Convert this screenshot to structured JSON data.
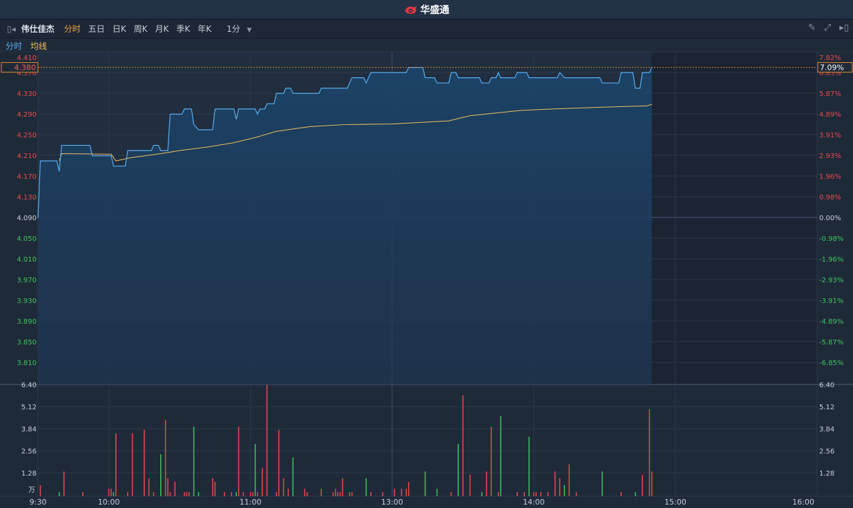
{
  "titlebar": {
    "app_name": "华盛通"
  },
  "toolbar": {
    "stock_name": "伟仕佳杰",
    "tabs": [
      {
        "label": "分时",
        "active": true
      },
      {
        "label": "五日"
      },
      {
        "label": "日K"
      },
      {
        "label": "周K"
      },
      {
        "label": "月K"
      },
      {
        "label": "季K"
      },
      {
        "label": "年K"
      }
    ],
    "interval": {
      "label": "1分"
    },
    "tools": [
      "pencil-icon",
      "fullscreen-icon",
      "collapse-right-icon"
    ]
  },
  "legend": {
    "price_label": "分时",
    "avg_label": "均线"
  },
  "colors": {
    "price_line": "#5aaef0",
    "avg_line": "#f0c060",
    "up": "#e84a4a",
    "down": "#3ec55e",
    "highlight": "#e08a2a"
  },
  "chart_data": [
    {
      "type": "line",
      "left_axis_ticks": [
        "4.410",
        "4.370",
        "4.330",
        "4.290",
        "4.250",
        "4.210",
        "4.170",
        "4.130",
        "4.090",
        "4.050",
        "4.010",
        "3.970",
        "3.930",
        "3.890",
        "3.850",
        "3.810"
      ],
      "right_axis_ticks": [
        "7.82%",
        "6.85%",
        "5.87%",
        "4.89%",
        "3.91%",
        "2.93%",
        "1.96%",
        "0.98%",
        "0.00%",
        "-0.98%",
        "-1.96%",
        "-2.93%",
        "-3.91%",
        "-4.89%",
        "-5.87%",
        "-6.85%"
      ],
      "ylim": [
        3.77,
        4.41
      ],
      "prev_close": 4.09,
      "current": {
        "price": "4.380",
        "change_pct": "7.09%"
      },
      "x_ticks": [
        "9:30",
        "10:00",
        "11:00",
        "13:00",
        "14:00",
        "15:00",
        "16:00"
      ],
      "sessions": [
        [
          "9:30",
          "12:00"
        ],
        [
          "13:00",
          "16:00"
        ]
      ],
      "series": [
        {
          "name": "分时",
          "points": [
            [
              "9:30",
              4.09
            ],
            [
              "9:31",
              4.2
            ],
            [
              "9:38",
              4.2
            ],
            [
              "9:39",
              4.18
            ],
            [
              "9:40",
              4.23
            ],
            [
              "9:52",
              4.23
            ],
            [
              "9:53",
              4.21
            ],
            [
              "10:01",
              4.21
            ],
            [
              "10:02",
              4.19
            ],
            [
              "10:07",
              4.19
            ],
            [
              "10:08",
              4.22
            ],
            [
              "10:18",
              4.22
            ],
            [
              "10:19",
              4.23
            ],
            [
              "10:21",
              4.23
            ],
            [
              "10:22",
              4.22
            ],
            [
              "10:25",
              4.22
            ],
            [
              "10:26",
              4.29
            ],
            [
              "10:31",
              4.29
            ],
            [
              "10:32",
              4.3
            ],
            [
              "10:35",
              4.3
            ],
            [
              "10:36",
              4.27
            ],
            [
              "10:38",
              4.26
            ],
            [
              "10:44",
              4.26
            ],
            [
              "10:45",
              4.3
            ],
            [
              "10:53",
              4.3
            ],
            [
              "10:54",
              4.28
            ],
            [
              "10:55",
              4.3
            ],
            [
              "11:02",
              4.3
            ],
            [
              "11:03",
              4.29
            ],
            [
              "11:04",
              4.3
            ],
            [
              "11:06",
              4.3
            ],
            [
              "11:07",
              4.31
            ],
            [
              "11:10",
              4.31
            ],
            [
              "11:11",
              4.33
            ],
            [
              "11:14",
              4.33
            ],
            [
              "11:15",
              4.34
            ],
            [
              "11:17",
              4.34
            ],
            [
              "11:18",
              4.33
            ],
            [
              "11:29",
              4.33
            ],
            [
              "11:30",
              4.34
            ],
            [
              "11:41",
              4.34
            ],
            [
              "11:43",
              4.36
            ],
            [
              "11:48",
              4.36
            ],
            [
              "11:49",
              4.35
            ],
            [
              "11:51",
              4.37
            ],
            [
              "12:00",
              4.37
            ],
            [
              "13:06",
              4.37
            ],
            [
              "13:07",
              4.38
            ],
            [
              "13:13",
              4.38
            ],
            [
              "13:14",
              4.36
            ],
            [
              "13:18",
              4.36
            ],
            [
              "13:19",
              4.35
            ],
            [
              "13:24",
              4.35
            ],
            [
              "13:25",
              4.37
            ],
            [
              "13:27",
              4.37
            ],
            [
              "13:28",
              4.36
            ],
            [
              "13:37",
              4.36
            ],
            [
              "13:38",
              4.35
            ],
            [
              "13:41",
              4.35
            ],
            [
              "13:42",
              4.36
            ],
            [
              "13:44",
              4.36
            ],
            [
              "13:45",
              4.37
            ],
            [
              "13:46",
              4.36
            ],
            [
              "13:52",
              4.36
            ],
            [
              "13:53",
              4.37
            ],
            [
              "13:57",
              4.37
            ],
            [
              "13:58",
              4.36
            ],
            [
              "14:10",
              4.36
            ],
            [
              "14:11",
              4.37
            ],
            [
              "14:13",
              4.36
            ],
            [
              "14:28",
              4.36
            ],
            [
              "14:29",
              4.35
            ],
            [
              "14:36",
              4.35
            ],
            [
              "14:37",
              4.37
            ],
            [
              "14:42",
              4.37
            ],
            [
              "14:43",
              4.34
            ],
            [
              "14:45",
              4.34
            ],
            [
              "14:46",
              4.37
            ],
            [
              "14:49",
              4.37
            ],
            [
              "14:50",
              4.38
            ]
          ]
        },
        {
          "name": "均线",
          "points": [
            [
              "9:39",
              4.2
            ],
            [
              "9:40",
              4.214
            ],
            [
              "10:01",
              4.213
            ],
            [
              "10:03",
              4.2
            ],
            [
              "10:09",
              4.206
            ],
            [
              "10:22",
              4.214
            ],
            [
              "10:30",
              4.22
            ],
            [
              "10:42",
              4.227
            ],
            [
              "10:53",
              4.235
            ],
            [
              "11:02",
              4.245
            ],
            [
              "11:11",
              4.257
            ],
            [
              "11:25",
              4.266
            ],
            [
              "11:40",
              4.27
            ],
            [
              "12:00",
              4.271
            ],
            [
              "13:24",
              4.277
            ],
            [
              "13:33",
              4.287
            ],
            [
              "13:54",
              4.297
            ],
            [
              "14:08",
              4.3
            ],
            [
              "14:26",
              4.303
            ],
            [
              "14:48",
              4.306
            ],
            [
              "14:50",
              4.309
            ]
          ]
        }
      ]
    },
    {
      "type": "bar",
      "unit": "万",
      "axis_ticks": [
        "6.40",
        "5.12",
        "3.84",
        "2.56",
        "1.28"
      ],
      "ylim": [
        0,
        6.4
      ],
      "bars": [
        [
          "9:31",
          0.64,
          "up"
        ],
        [
          "9:39",
          0.24,
          "down"
        ],
        [
          "9:41",
          1.42,
          "up"
        ],
        [
          "9:49",
          0.24,
          "up"
        ],
        [
          "10:00",
          0.43,
          "up"
        ],
        [
          "10:01",
          0.43,
          "up"
        ],
        [
          "10:02",
          0.24,
          "down"
        ],
        [
          "10:03",
          3.6,
          "up"
        ],
        [
          "10:08",
          0.24,
          "up"
        ],
        [
          "10:10",
          3.6,
          "up"
        ],
        [
          "10:15",
          3.8,
          "up"
        ],
        [
          "10:17",
          1.03,
          "up"
        ],
        [
          "10:19",
          0.24,
          "up"
        ],
        [
          "10:22",
          2.4,
          "down"
        ],
        [
          "10:24",
          4.38,
          "up"
        ],
        [
          "10:25",
          1.03,
          "up"
        ],
        [
          "10:26",
          0.24,
          "up"
        ],
        [
          "10:28",
          0.83,
          "up"
        ],
        [
          "10:32",
          0.24,
          "up"
        ],
        [
          "10:33",
          0.24,
          "up"
        ],
        [
          "10:34",
          0.24,
          "up"
        ],
        [
          "10:36",
          3.99,
          "down"
        ],
        [
          "10:38",
          0.24,
          "down"
        ],
        [
          "10:44",
          1.03,
          "up"
        ],
        [
          "10:45",
          0.83,
          "up"
        ],
        [
          "10:49",
          0.24,
          "up"
        ],
        [
          "10:52",
          0.24,
          "up"
        ],
        [
          "10:54",
          0.24,
          "down"
        ],
        [
          "10:55",
          3.99,
          "up"
        ],
        [
          "10:57",
          0.24,
          "up"
        ],
        [
          "11:00",
          0.24,
          "up"
        ],
        [
          "11:01",
          0.24,
          "up"
        ],
        [
          "11:02",
          3.0,
          "down"
        ],
        [
          "11:03",
          0.24,
          "up"
        ],
        [
          "11:05",
          1.63,
          "up"
        ],
        [
          "11:07",
          6.37,
          "up"
        ],
        [
          "11:11",
          0.24,
          "up"
        ],
        [
          "11:12",
          3.8,
          "up"
        ],
        [
          "11:14",
          1.03,
          "up"
        ],
        [
          "11:16",
          0.43,
          "up"
        ],
        [
          "11:18",
          2.22,
          "down"
        ],
        [
          "11:23",
          0.43,
          "up"
        ],
        [
          "11:24",
          0.24,
          "up"
        ],
        [
          "11:30",
          0.43,
          "up"
        ],
        [
          "11:35",
          0.24,
          "up"
        ],
        [
          "11:36",
          0.43,
          "up"
        ],
        [
          "11:37",
          0.24,
          "up"
        ],
        [
          "11:38",
          0.24,
          "up"
        ],
        [
          "11:39",
          1.03,
          "up"
        ],
        [
          "11:42",
          0.24,
          "up"
        ],
        [
          "11:43",
          0.24,
          "up"
        ],
        [
          "11:49",
          1.03,
          "down"
        ],
        [
          "11:51",
          0.24,
          "up"
        ],
        [
          "11:56",
          0.24,
          "up"
        ],
        [
          "13:01",
          0.43,
          "up"
        ],
        [
          "13:04",
          0.43,
          "up"
        ],
        [
          "13:06",
          0.43,
          "up"
        ],
        [
          "13:07",
          0.83,
          "up"
        ],
        [
          "13:14",
          1.42,
          "down"
        ],
        [
          "13:19",
          0.43,
          "down"
        ],
        [
          "13:25",
          0.24,
          "up"
        ],
        [
          "13:28",
          3.0,
          "down"
        ],
        [
          "13:30",
          5.78,
          "up"
        ],
        [
          "13:33",
          1.23,
          "up"
        ],
        [
          "13:38",
          0.24,
          "down"
        ],
        [
          "13:40",
          1.42,
          "up"
        ],
        [
          "13:42",
          3.99,
          "up"
        ],
        [
          "13:45",
          0.24,
          "up"
        ],
        [
          "13:46",
          4.6,
          "down"
        ],
        [
          "13:53",
          0.24,
          "up"
        ],
        [
          "13:56",
          0.24,
          "up"
        ],
        [
          "13:58",
          3.4,
          "down"
        ],
        [
          "14:00",
          0.24,
          "up"
        ],
        [
          "14:01",
          0.24,
          "up"
        ],
        [
          "14:03",
          0.24,
          "up"
        ],
        [
          "14:06",
          0.24,
          "up"
        ],
        [
          "14:09",
          1.42,
          "up"
        ],
        [
          "14:11",
          1.03,
          "up"
        ],
        [
          "14:13",
          0.64,
          "down"
        ],
        [
          "14:15",
          1.83,
          "up"
        ],
        [
          "14:18",
          0.24,
          "up"
        ],
        [
          "14:29",
          1.42,
          "down"
        ],
        [
          "14:37",
          0.24,
          "up"
        ],
        [
          "14:43",
          0.24,
          "down"
        ],
        [
          "14:46",
          1.23,
          "up"
        ],
        [
          "14:49",
          4.99,
          "up"
        ],
        [
          "14:50",
          1.42,
          "up"
        ]
      ]
    }
  ]
}
